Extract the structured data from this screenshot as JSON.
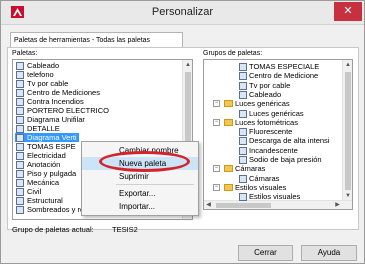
{
  "window": {
    "title": "Personalizar",
    "close_glyph": "✕"
  },
  "tab": {
    "label": "Paletas de herramientas - Todas las paletas"
  },
  "palettes": {
    "label": "Paletas:",
    "items": [
      "Cableado",
      "telefono",
      "Tv por cable",
      "Centro de Mediciones",
      "Contra Incendios",
      "PORTERO ELECTRICO",
      "Diagrama Unifilar",
      "DETALLE",
      "Diagrama Verti",
      "TOMAS ESPE",
      "Electricidad",
      "Anotación",
      "Piso y pulgada",
      "Mecánica",
      "Civil",
      "Estructural",
      "Sombreados y rellenos"
    ],
    "selected_index": 8
  },
  "groups": {
    "label": "Grupos de paletas:",
    "items": [
      {
        "text": "TOMAS ESPECIALE",
        "type": "palette",
        "indent": 2
      },
      {
        "text": "Centro de Medicione",
        "type": "palette",
        "indent": 2
      },
      {
        "text": "Tv por cable",
        "type": "palette",
        "indent": 2
      },
      {
        "text": "Cableado",
        "type": "palette",
        "indent": 2
      },
      {
        "text": "Luces genéricas",
        "type": "folder",
        "indent": 1,
        "expander": "−"
      },
      {
        "text": "Luces genéricas",
        "type": "palette",
        "indent": 2
      },
      {
        "text": "Luces fotométricas",
        "type": "folder",
        "indent": 1,
        "expander": "−"
      },
      {
        "text": "Fluorescente",
        "type": "palette",
        "indent": 2
      },
      {
        "text": "Descarga de alta intensi",
        "type": "palette",
        "indent": 2
      },
      {
        "text": "Incandescente",
        "type": "palette",
        "indent": 2
      },
      {
        "text": "Sodio de baja presión",
        "type": "palette",
        "indent": 2
      },
      {
        "text": "Cámaras",
        "type": "folder",
        "indent": 1,
        "expander": "−"
      },
      {
        "text": "Cámaras",
        "type": "palette",
        "indent": 2
      },
      {
        "text": "Estilos visuales",
        "type": "folder",
        "indent": 1,
        "expander": "−"
      },
      {
        "text": "Estilos visuales",
        "type": "palette",
        "indent": 2
      }
    ]
  },
  "current_group": {
    "label": "Grupo de paletas actual:",
    "value": "TESIS2"
  },
  "context_menu": {
    "items": [
      "Cambiar nombre",
      "Nueva paleta",
      "Suprimir",
      "Exportar...",
      "Importar..."
    ],
    "highlighted_index": 1
  },
  "buttons": {
    "close": "Cerrar",
    "help": "Ayuda"
  },
  "colors": {
    "selection": "#3399ff",
    "close_button": "#c9303f",
    "highlight_ellipse": "#d3232d",
    "menu_hover": "#cce4f7"
  }
}
